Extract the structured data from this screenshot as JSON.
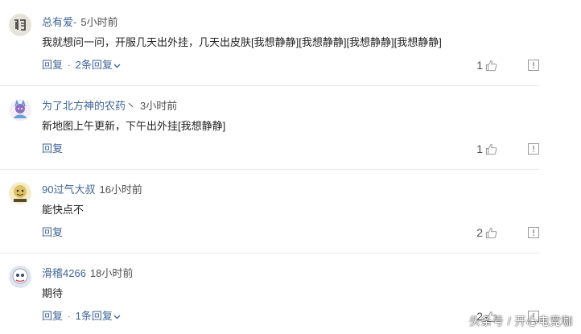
{
  "comments": [
    {
      "username": "总有爱-",
      "time": "5小时前",
      "text": "我就想问一问，开服几天出外挂，几天出皮肤[我想静静][我想静静][我想静静][我想静静]",
      "reply_label": "回复",
      "dot": "·",
      "replies_label": "2条回复",
      "likes": "1"
    },
    {
      "username": "为了北方神的农药丶",
      "time": "3小时前",
      "text": "新地图上午更新，下午出外挂[我想静静]",
      "reply_label": "回复",
      "likes": "1"
    },
    {
      "username": "90过气大叔",
      "time": "16小时前",
      "text": "能快点不",
      "reply_label": "回复",
      "likes": "2"
    },
    {
      "username": "滑稽4266",
      "time": "18小时前",
      "text": "期待",
      "reply_label": "回复",
      "dot": "·",
      "replies_label": "1条回复",
      "likes": "2"
    }
  ],
  "watermark": "头条号 / 开心电竞咖",
  "colors": {
    "link": "#406599",
    "text": "#222222",
    "meta": "#505050",
    "divider": "#e8e8e8"
  },
  "icons": {
    "like": "thumbs-up-icon",
    "report": "report-icon",
    "expand": "chevron-down-icon"
  }
}
